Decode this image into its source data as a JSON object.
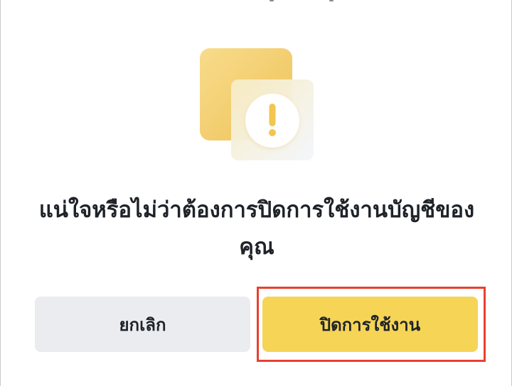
{
  "dialog": {
    "title": "แน่ใจหรือไม่ว่าต้องการปิดการใช้งานบัญชีของคุณ",
    "illustration_icon": "warning-exclamation-icon",
    "cancel_label": "ยกเลิก",
    "confirm_label": "ปิดการใช้งาน"
  },
  "colors": {
    "confirm_button": "#F5D456",
    "cancel_button": "#EAECEF",
    "highlight_frame": "#E8402F",
    "icon_yellow": "#F0C75A",
    "text": "#1E2329"
  }
}
